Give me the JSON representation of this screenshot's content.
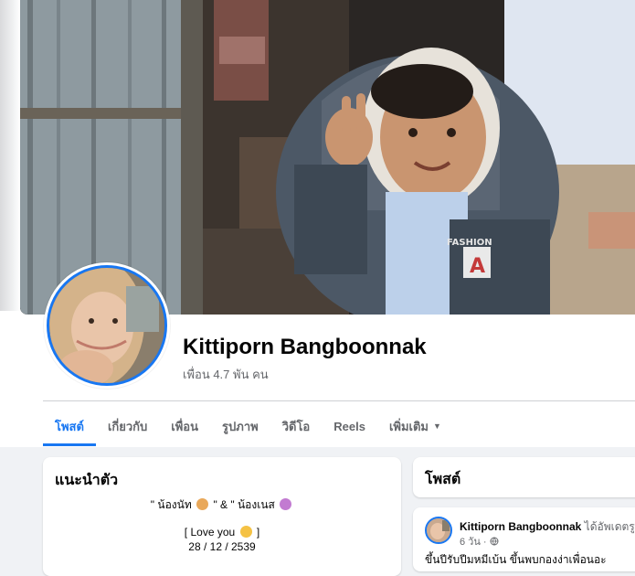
{
  "profile": {
    "name": "Kittiporn Bangboonnak",
    "friends": "เพื่อน 4.7 พัน คน"
  },
  "tabs": [
    {
      "label": "โพสต์",
      "active": true
    },
    {
      "label": "เกี่ยวกับ"
    },
    {
      "label": "เพื่อน"
    },
    {
      "label": "รูปภาพ"
    },
    {
      "label": "วิดีโอ"
    },
    {
      "label": "Reels"
    },
    {
      "label": "เพิ่มเติม",
      "icon": "caret-down-icon"
    }
  ],
  "intro": {
    "title": "แนะนำตัว",
    "bio_line1_a": "\" น้องนัท",
    "bio_line1_b": "\" & \" น้องเนส",
    "bio_line2": "[ Love you",
    "bio_line2_end": "]",
    "bio_line3": "28 / 12 / 2539"
  },
  "posts": {
    "title": "โพสต์",
    "first": {
      "author": "Kittiporn Bangboonnak",
      "action": "ได้อัพเดตรูป",
      "time": "6 วัน ·",
      "privacy_icon": "globe-icon",
      "snippet": "ขึ้นปีรับปีมหมีเบ้น ขึ้นพบกองง่าเพื่อนอะ"
    }
  },
  "colors": {
    "accent": "#1877f2",
    "secondary_text": "#65676b",
    "background": "#f0f2f5"
  }
}
